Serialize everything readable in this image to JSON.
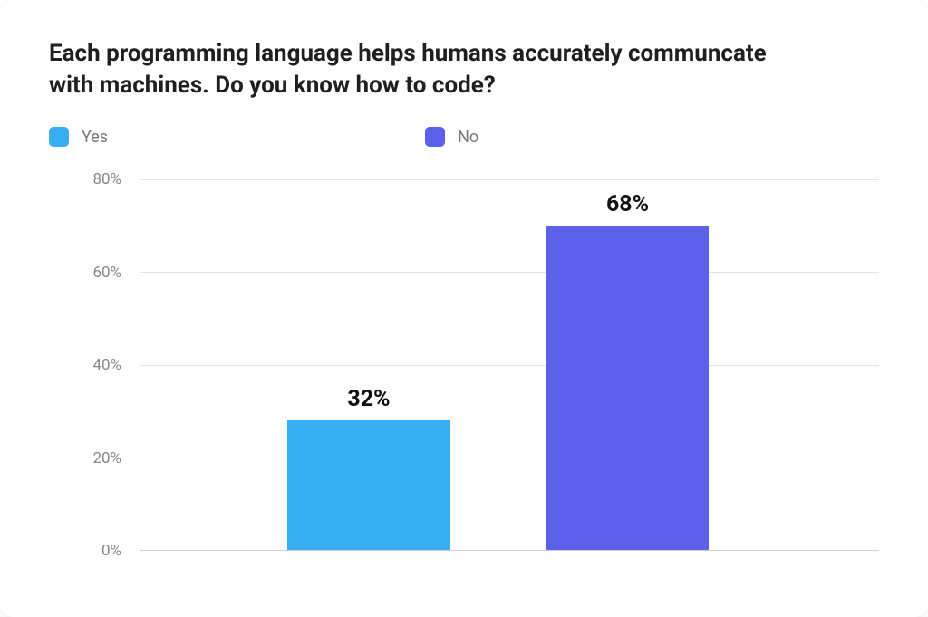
{
  "chart_data": {
    "type": "bar",
    "title": "Each programming language helps humans accurately communcate with machines. Do you know how to code?",
    "categories": [
      "Yes",
      "No"
    ],
    "values": [
      32,
      68
    ],
    "value_labels": [
      "32%",
      "68%"
    ],
    "series_colors": [
      "#36aef1",
      "#5b61eb"
    ],
    "ylim": [
      0,
      80
    ],
    "y_ticks": [
      "0%",
      "20%",
      "40%",
      "60%",
      "80%"
    ],
    "y_tick_values": [
      0,
      20,
      40,
      60,
      80
    ],
    "bar_heights_scaled": [
      28,
      70
    ],
    "xlabel": "",
    "ylabel": ""
  },
  "legend": {
    "items": [
      {
        "label": "Yes",
        "color": "#36aef1"
      },
      {
        "label": "No",
        "color": "#5b61eb"
      }
    ]
  }
}
